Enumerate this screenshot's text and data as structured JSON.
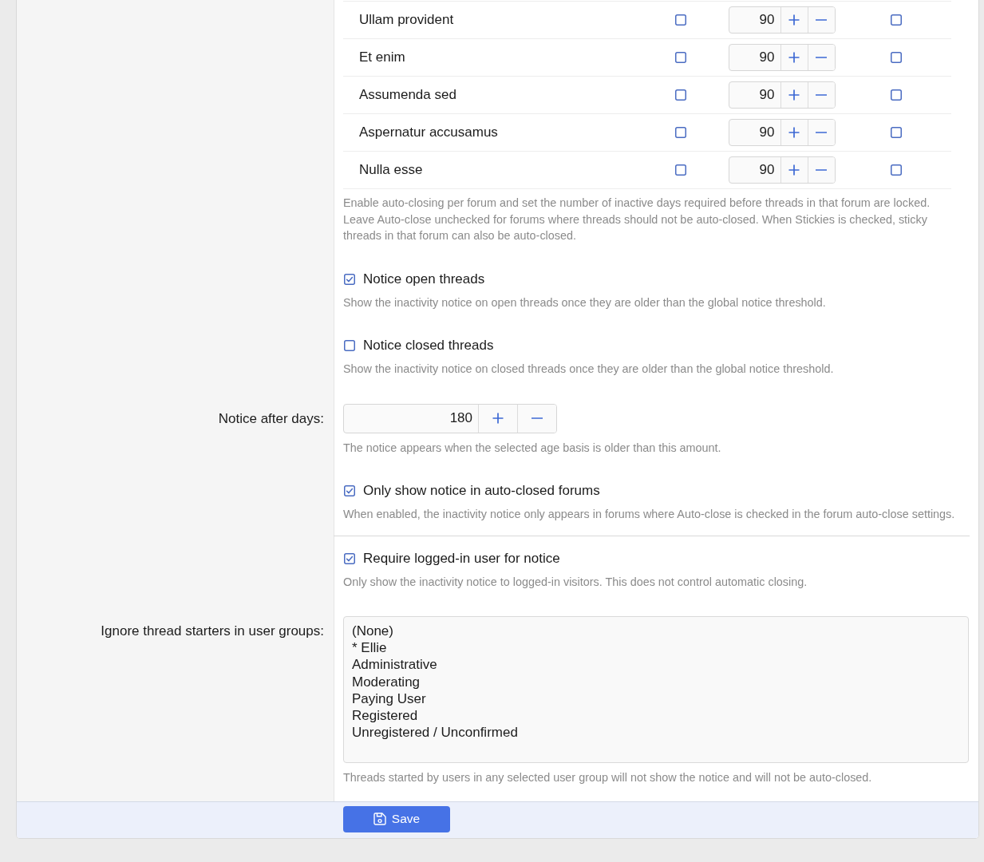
{
  "forum_table": {
    "rows": [
      {
        "name": "Ullam provident",
        "auto_close": false,
        "days": "90",
        "stickies": false
      },
      {
        "name": "Et enim",
        "auto_close": false,
        "days": "90",
        "stickies": false
      },
      {
        "name": "Assumenda sed",
        "auto_close": false,
        "days": "90",
        "stickies": false
      },
      {
        "name": "Aspernatur accusamus",
        "auto_close": false,
        "days": "90",
        "stickies": false
      },
      {
        "name": "Nulla esse",
        "auto_close": false,
        "days": "90",
        "stickies": false
      }
    ],
    "help": "Enable auto-closing per forum and set the number of inactive days required before threads in that forum are locked. Leave Auto-close unchecked for forums where threads should not be auto-closed. When Stickies is checked, sticky threads in that forum can also be auto-closed."
  },
  "groups": [
    {
      "settings": [
        {
          "kind": "checkbox",
          "label": "Notice open threads",
          "checked": true,
          "help": "Show the inactivity notice on open threads once they are older than the global notice threshold."
        },
        {
          "kind": "checkbox",
          "label": "Notice closed threads",
          "checked": false,
          "help": "Show the inactivity notice on closed threads once they are older than the global notice threshold."
        },
        {
          "kind": "number",
          "label": "Notice after days:",
          "value": "180",
          "help": "The notice appears when the selected age basis is older than this amount."
        },
        {
          "kind": "checkbox",
          "label": "Only show notice in auto-closed forums",
          "checked": true,
          "help": "When enabled, the inactivity notice only appears in forums where Auto-close is checked in the forum auto-close settings."
        }
      ]
    },
    {
      "settings": [
        {
          "kind": "checkbox",
          "label": "Require logged-in user for notice",
          "checked": true,
          "help": "Only show the inactivity notice to logged-in visitors. This does not control automatic closing."
        },
        {
          "kind": "listbox",
          "label": "Ignore thread starters in user groups:",
          "options": [
            {
              "text": "(None)",
              "selected": false
            },
            {
              "text": "* Ellie",
              "selected": false
            },
            {
              "text": "Administrative",
              "selected": false
            },
            {
              "text": "Moderating",
              "selected": false
            },
            {
              "text": "Paying User",
              "selected": false
            },
            {
              "text": "Registered",
              "selected": false
            },
            {
              "text": "Unregistered / Unconfirmed",
              "selected": false
            }
          ],
          "help": "Threads started by users in any selected user group will not show the notice and will not be auto-closed."
        }
      ]
    }
  ],
  "save_button": {
    "label": "Save"
  }
}
